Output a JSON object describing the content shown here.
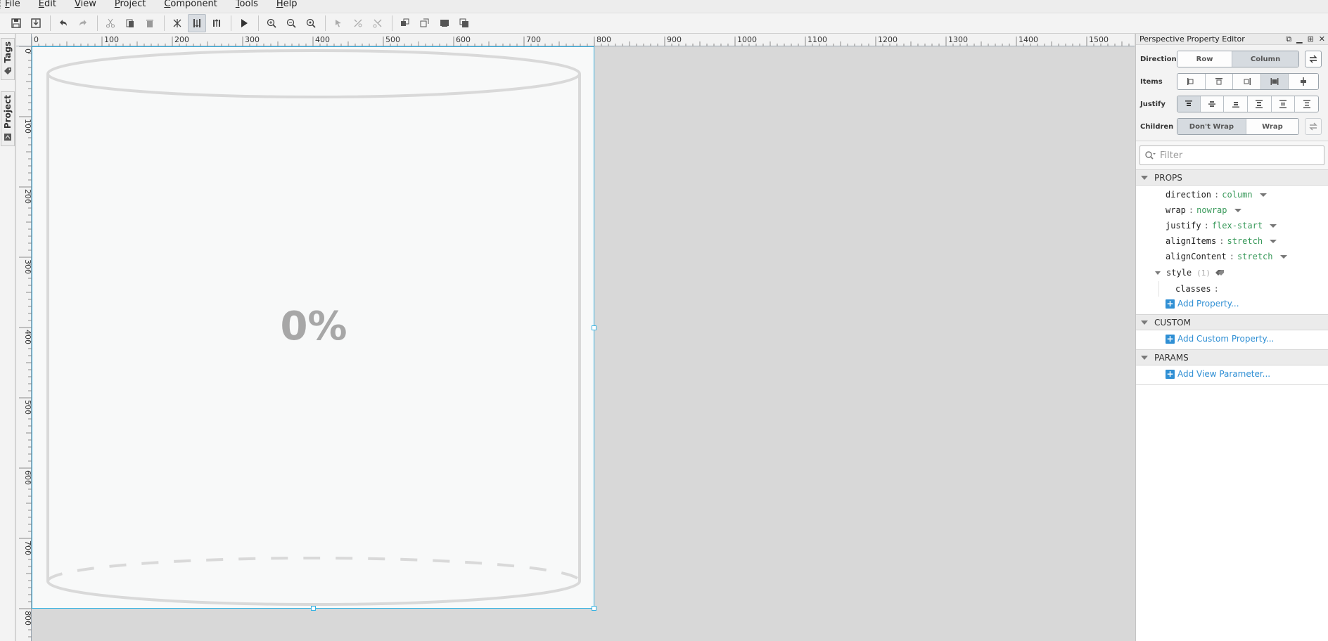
{
  "menubar": {
    "items": [
      "File",
      "Edit",
      "View",
      "Project",
      "Component",
      "Tools",
      "Help"
    ]
  },
  "toolbar": {
    "buttons": [
      "save-icon",
      "save-all-icon",
      "undo-icon",
      "redo-icon",
      "cut-icon",
      "copy-icon",
      "delete-icon",
      "deep-selection-icon",
      "column-direction-icon",
      "row-direction-icon",
      "preview-icon",
      "zoom-in-icon",
      "zoom-out-icon",
      "zoom-actual-icon",
      "pointer-icon",
      "bind-icon",
      "cross-icon",
      "group-icon",
      "ungroup-icon",
      "send-back-icon",
      "bring-front-icon"
    ]
  },
  "left_dock": {
    "tabs": [
      "Tags",
      "Project"
    ]
  },
  "rulers": {
    "horizontal_labels": [
      "0",
      "100",
      "200",
      "300",
      "400",
      "500",
      "600",
      "700",
      "800",
      "900",
      "1000",
      "1100",
      "1200",
      "1300",
      "1400",
      "1500"
    ],
    "vertical_labels": [
      "0",
      "100",
      "200",
      "300",
      "400",
      "500",
      "600",
      "700",
      "800"
    ]
  },
  "canvas": {
    "tank_level_text": "0%",
    "tank_fill": 0,
    "colors": {
      "selection": "#36b3e3",
      "tank_outline": "#d9d9d9",
      "level_text": "#a7a7a7",
      "canvas_bg": "#f8f9f9"
    }
  },
  "property_editor": {
    "title": "Perspective Property Editor",
    "layout": {
      "direction": {
        "label": "Direction",
        "options": [
          "Row",
          "Column"
        ],
        "selected": "Column"
      },
      "items": {
        "label": "Items",
        "selected_index": 4
      },
      "justify": {
        "label": "Justify",
        "selected_index": 0
      },
      "children": {
        "label": "Children",
        "options": [
          "Don't Wrap",
          "Wrap"
        ],
        "selected": "Don't Wrap"
      }
    },
    "filter_placeholder": "Filter",
    "sections": {
      "props": {
        "title": "PROPS",
        "rows": [
          {
            "key": "direction",
            "value": "column"
          },
          {
            "key": "wrap",
            "value": "nowrap"
          },
          {
            "key": "justify",
            "value": "flex-start"
          },
          {
            "key": "alignItems",
            "value": "stretch"
          },
          {
            "key": "alignContent",
            "value": "stretch"
          }
        ],
        "style": {
          "key": "style",
          "count": "(1)",
          "child_key": "classes"
        },
        "add_label": "Add Property..."
      },
      "custom": {
        "title": "CUSTOM",
        "add_label": "Add Custom Property..."
      },
      "params": {
        "title": "PARAMS",
        "add_label": "Add View Parameter..."
      }
    },
    "accent_color": "#2f8fd4",
    "value_color": "#3a9a5b"
  }
}
